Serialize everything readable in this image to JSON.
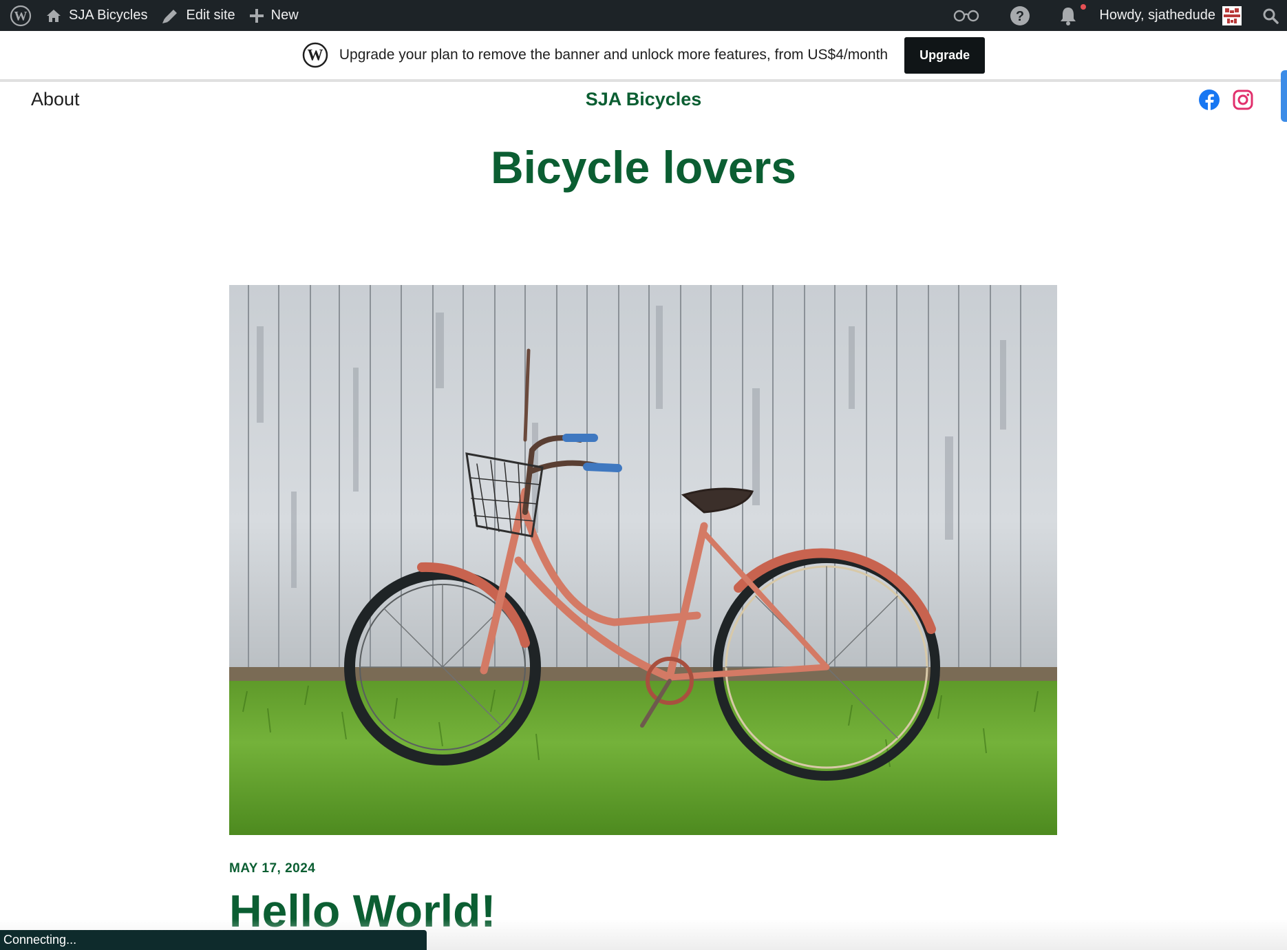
{
  "admin_bar": {
    "site_name": "SJA Bicycles",
    "edit_site": "Edit site",
    "new": "New",
    "howdy": "Howdy, sjathedude",
    "icons": [
      "wordpress-logo-icon",
      "home-icon",
      "edit-pencil-icon",
      "plus-icon",
      "reader-glasses-icon",
      "help-icon",
      "bell-icon",
      "search-icon"
    ],
    "notification_dot_color": "#e65054"
  },
  "banner": {
    "message": "Upgrade your plan to remove the banner and unlock more features, from US$4/month",
    "button": "Upgrade"
  },
  "header": {
    "nav_about": "About",
    "site_title": "SJA Bicycles",
    "social": [
      "facebook-icon",
      "instagram-icon"
    ]
  },
  "page": {
    "heading": "Bicycle lovers"
  },
  "post": {
    "date": "MAY 17, 2024",
    "title": "Hello World!"
  },
  "status": {
    "text": "Connecting..."
  },
  "colors": {
    "accent_green": "#0b5e32",
    "admin_bar_bg": "#1d2327",
    "facebook_blue": "#1877f2",
    "instagram_pink": "#e1306c"
  }
}
